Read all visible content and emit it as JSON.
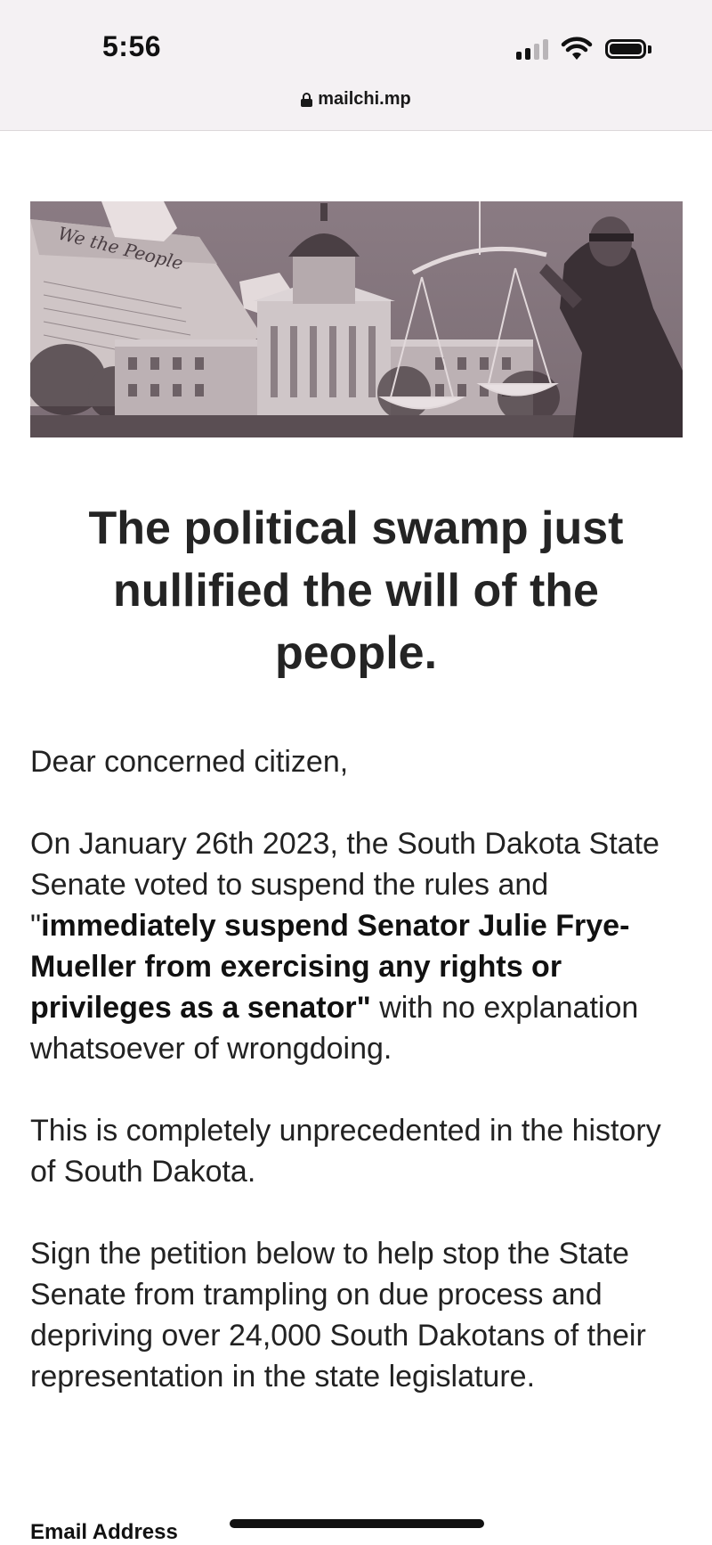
{
  "status_bar": {
    "time": "5:56",
    "url": "mailchi.mp"
  },
  "hero": {
    "alt": "",
    "document_script": "We the People"
  },
  "headline": "The political swamp just nullified the will of the people.",
  "body": {
    "greeting": "Dear concerned citizen,",
    "p1_a": "On January 26th 2023, the South Dakota State Senate voted to suspend the rules and \"",
    "p1_bold": "immediately suspend Senator Julie Frye-Mueller from exercising any rights or privileges as a senator\"",
    "p1_b": " with no explanation whatsoever of wrongdoing.",
    "p2": "This is completely unprecedented in the history of South Dakota.",
    "p3": "Sign the petition below to help stop the State Senate from trampling on due process and depriving over 24,000 South Dakotans of their representation in the state legislature."
  },
  "form": {
    "email_label": "Email Address"
  },
  "colors": {
    "status_bg": "#f4f1f3",
    "hero_tint": "#8b7d84",
    "text": "#222222"
  }
}
